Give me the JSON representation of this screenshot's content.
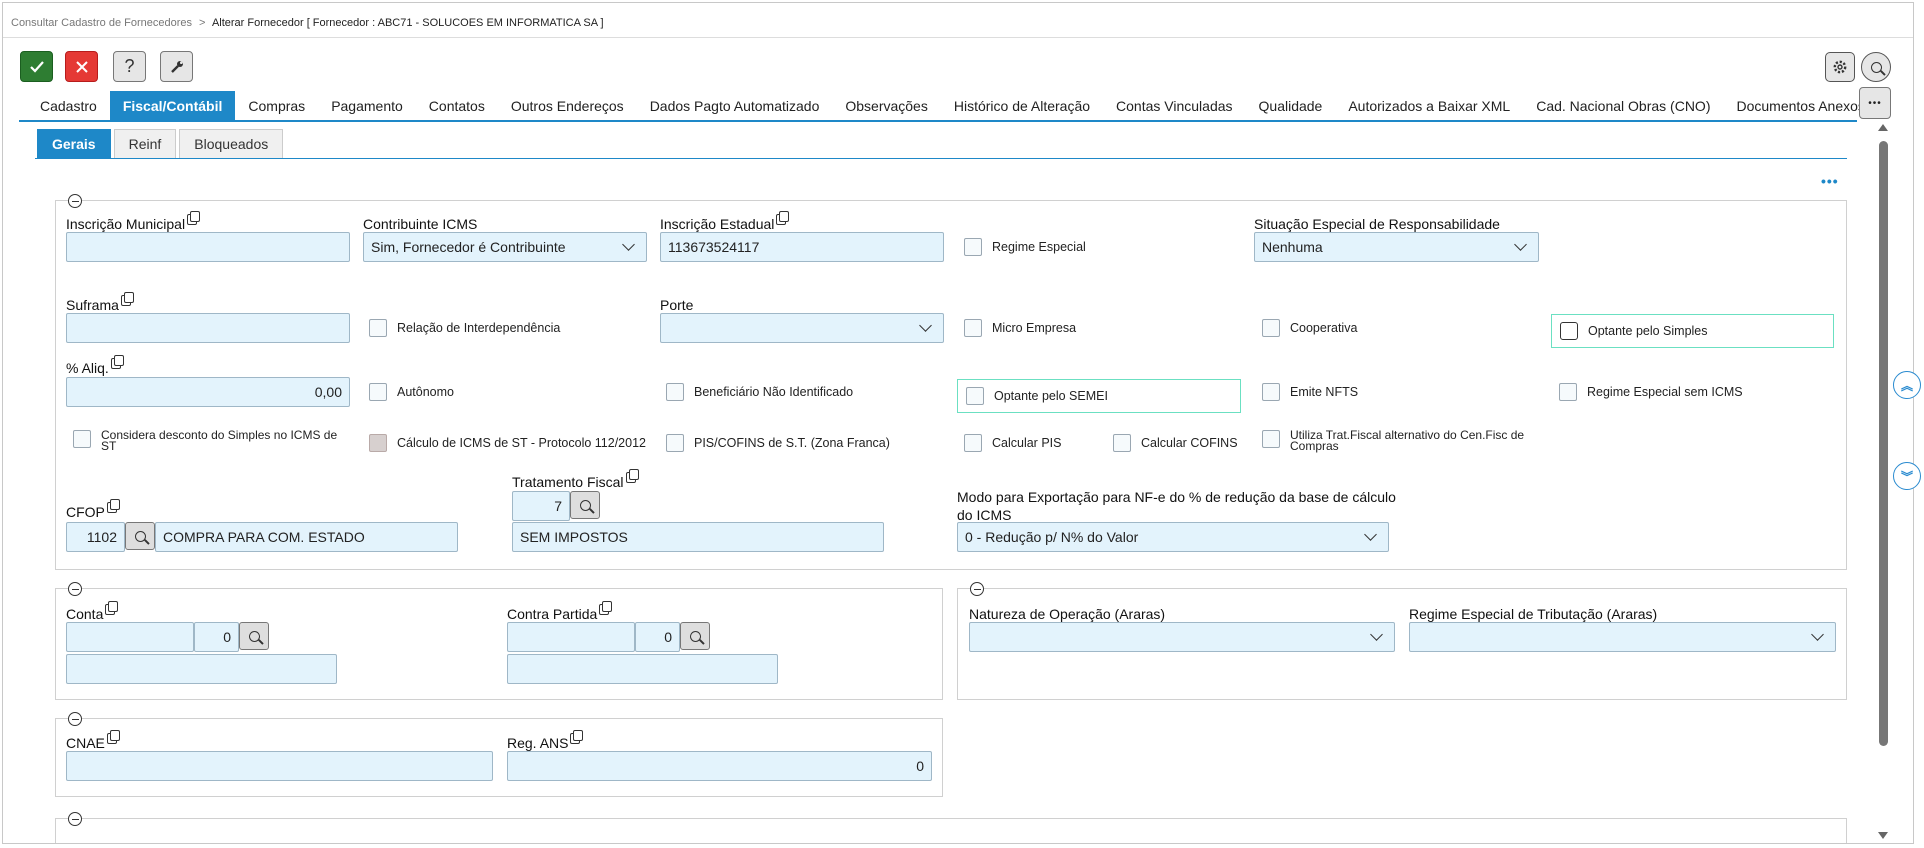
{
  "breadcrumb": {
    "parent": "Consultar Cadastro de Fornecedores",
    "separator": ">",
    "current": "Alterar Fornecedor [ Fornecedor : ABC71 - SOLUCOES EM INFORMATICA SA ]"
  },
  "toolbar": {
    "confirm_icon": "check-icon",
    "cancel_icon": "close-icon",
    "help_label": "?",
    "tools_icon": "wrench-icon"
  },
  "tabs": [
    "Cadastro",
    "Fiscal/Contábil",
    "Compras",
    "Pagamento",
    "Contatos",
    "Outros Endereços",
    "Dados Pagto Automatizado",
    "Observações",
    "Histórico de Alteração",
    "Contas Vinculadas",
    "Qualidade",
    "Autorizados a Baixar XML",
    "Cad. Nacional Obras (CNO)",
    "Documentos Anexos"
  ],
  "active_tab": "Fiscal/Contábil",
  "subtabs": [
    "Gerais",
    "Reinf",
    "Bloqueados"
  ],
  "more_label": "•••",
  "fields": {
    "inscricao_municipal": {
      "label": "Inscrição Municipal",
      "value": ""
    },
    "contribuinte_icms": {
      "label": "Contribuinte ICMS",
      "value": "Sim, Fornecedor é Contribuinte"
    },
    "inscricao_estadual": {
      "label": "Inscrição Estadual",
      "value": "113673524117"
    },
    "situacao_especial": {
      "label": "Situação Especial de Responsabilidade",
      "value": "Nenhuma"
    },
    "suframa": {
      "label": "Suframa",
      "value": ""
    },
    "porte": {
      "label": "Porte",
      "value": ""
    },
    "aliq": {
      "label": "% Aliq.",
      "value": "0,00"
    },
    "tratamento_fiscal": {
      "label": "Tratamento Fiscal",
      "code": "7",
      "desc": "SEM IMPOSTOS"
    },
    "cfop": {
      "label": "CFOP",
      "code": "1102",
      "desc": "COMPRA PARA COM. ESTADO"
    },
    "modo_exportacao": {
      "label_line1": "Modo para Exportação para NF-e do % de redução da base de cálculo",
      "label_line2": "do ICMS",
      "value": "0 - Redução p/ N% do Valor"
    },
    "conta": {
      "label": "Conta",
      "value": "",
      "num": "0",
      "desc": ""
    },
    "contra_partida": {
      "label": "Contra Partida",
      "value": "",
      "num": "0",
      "desc": ""
    },
    "natureza_operacao": {
      "label": "Natureza de Operação (Araras)",
      "value": ""
    },
    "regime_especial_trib": {
      "label": "Regime Especial de Tributação (Araras)",
      "value": ""
    },
    "cnae": {
      "label": "CNAE",
      "value": ""
    },
    "reg_ans": {
      "label": "Reg. ANS",
      "value": "0"
    }
  },
  "checks": {
    "regime_especial": "Regime Especial",
    "relacao_interdependencia": "Relação de Interdependência",
    "micro_empresa": "Micro Empresa",
    "cooperativa": "Cooperativa",
    "optante_simples": "Optante pelo Simples",
    "autonomo": "Autônomo",
    "beneficiario": "Beneficiário Não Identificado",
    "optante_semei": "Optante pelo SEMEI",
    "emite_nfts": "Emite NFTS",
    "regime_sem_icms": "Regime Especial sem ICMS",
    "considera_desconto_1": "Considera desconto do Simples no ICMS de",
    "considera_desconto_2": "ST",
    "calculo_icms_st": "Cálculo de ICMS de ST - Protocolo 112/2012",
    "pis_cofins_st": "PIS/COFINS de S.T. (Zona Franca)",
    "calcular_pis": "Calcular PIS",
    "calcular_cofins": "Calcular COFINS",
    "utiliza_trat_1": "Utiliza Trat.Fiscal alternativo do Cen.Fisc de",
    "utiliza_trat_2": "Compras"
  },
  "side": {
    "up_label": "︽",
    "down_label": "︾"
  }
}
